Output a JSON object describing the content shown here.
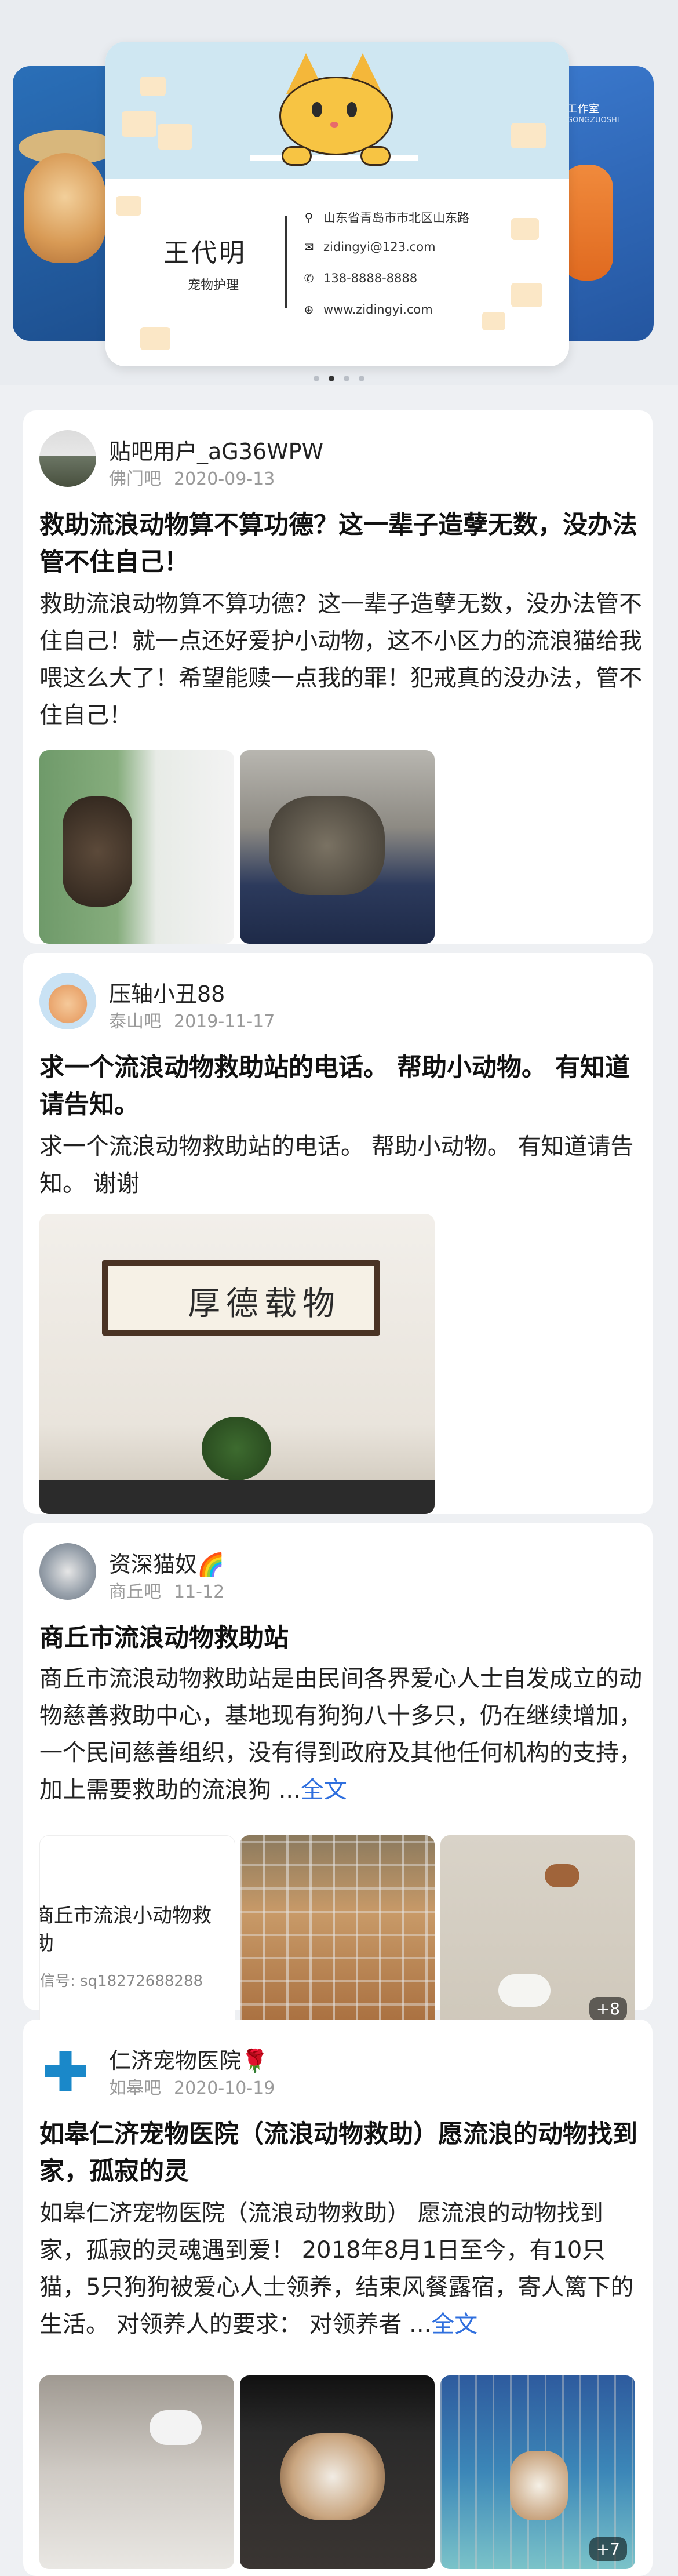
{
  "banner": {
    "card_name": "王代明",
    "card_role": "宠物护理",
    "address": "山东省青岛市市北区山东路",
    "email": "zidingyi@123.com",
    "phone": "138-8888-8888",
    "website": "www.zidingyi.com",
    "right_title": "工作室",
    "right_sub": "GONGZUOSHI",
    "slide_count": 4,
    "active_slide": 1
  },
  "posts": [
    {
      "user": "贴吧用户_aG36WPW",
      "forum": "佛门吧",
      "date": "2020-09-13",
      "title": "救助流浪动物算不算功德？这一辈子造孽无数，没办法管不住自己！",
      "body": "救助流浪动物算不算功德？这一辈子造孽无数，没办法管不住自己！就一点还好爱护小动物，这不小区力的流浪猫给我喂这么大了！希望能赎一点我的罪！犯戒真的没办法，管不住自己！",
      "more": ""
    },
    {
      "user": "压轴小丑88",
      "forum": "泰山吧",
      "date": "2019-11-17",
      "title": "求一个流浪动物救助站的电话。 帮助小动物。 有知道请告知。",
      "body": "求一个流浪动物救助站的电话。 帮助小动物。 有知道请告知。 谢谢",
      "more": "",
      "calligraphy": "厚德载物"
    },
    {
      "user": "资深猫奴🌈",
      "forum": "商丘吧",
      "date": "11-12",
      "title": "商丘市流浪动物救助站",
      "body": "商丘市流浪动物救助站是由民间各界爱心人士自发成立的动物慈善救助中心，基地现有狗狗八十多只，仍在继续增加，一个民间慈善组织，没有得到政府及其他任何机构的支持，加上需要救助的流浪狗 ...",
      "more": "全文",
      "img_text": "商丘市流浪小动物救",
      "img_text2": "助",
      "img_signal": "信号: sq18272688288",
      "extra_count": "+8"
    },
    {
      "user": "仁济宠物医院🌹",
      "forum": "如皋吧",
      "date": "2020-10-19",
      "title": "如皋仁济宠物医院（流浪动物救助）愿流浪的动物找到家，孤寂的灵",
      "body": "如皋仁济宠物医院（流浪动物救助） 愿流浪的动物找到家，孤寂的灵魂遇到爱！ 2018年8月1日至今，有10只猫，5只狗狗被爱心人士领养，结束风餐露宿，寄人篱下的生活。 对领养人的要求： 对领养者 ...",
      "more": "全文",
      "extra_count": "+7"
    }
  ],
  "colors": {
    "link": "#2f6fde",
    "card_top": "#cfe7f2",
    "page_bg": "#eef0f3"
  }
}
